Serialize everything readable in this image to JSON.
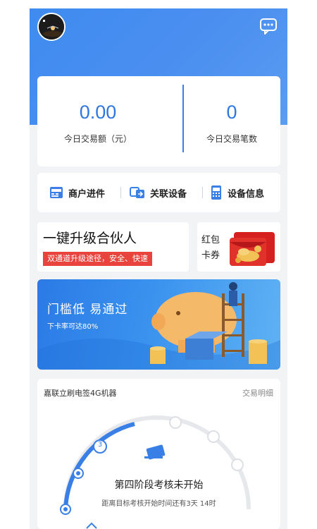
{
  "stats": {
    "trade_amount_value": "0.00",
    "trade_amount_label": "今日交易额（元）",
    "trade_count_value": "0",
    "trade_count_label": "今日交易笔数"
  },
  "menu": {
    "items": [
      {
        "label": "商户进件",
        "icon": "pos-icon"
      },
      {
        "label": "关联设备",
        "icon": "link-device-icon"
      },
      {
        "label": "设备信息",
        "icon": "device-info-icon"
      }
    ]
  },
  "upgrade": {
    "title": "一键升级合伙人",
    "badge": "双通道升级途径，安全、快速"
  },
  "red_packet": {
    "line1": "红包",
    "line2": "卡券"
  },
  "banner": {
    "title": "门槛低  易通过",
    "subtitle": "下卡率可达80%"
  },
  "progress": {
    "device_name": "嘉联立刷电签4G机器",
    "detail_link": "交易明细",
    "current_step_number": "3",
    "stage_title": "第四阶段考核未开始",
    "stage_subtitle": "距离目标考核开始时间还有3天 14时"
  },
  "colors": {
    "header_blue": "#3f8bf0",
    "accent_blue": "#2f77e0",
    "badge_red": "#e8433c"
  }
}
